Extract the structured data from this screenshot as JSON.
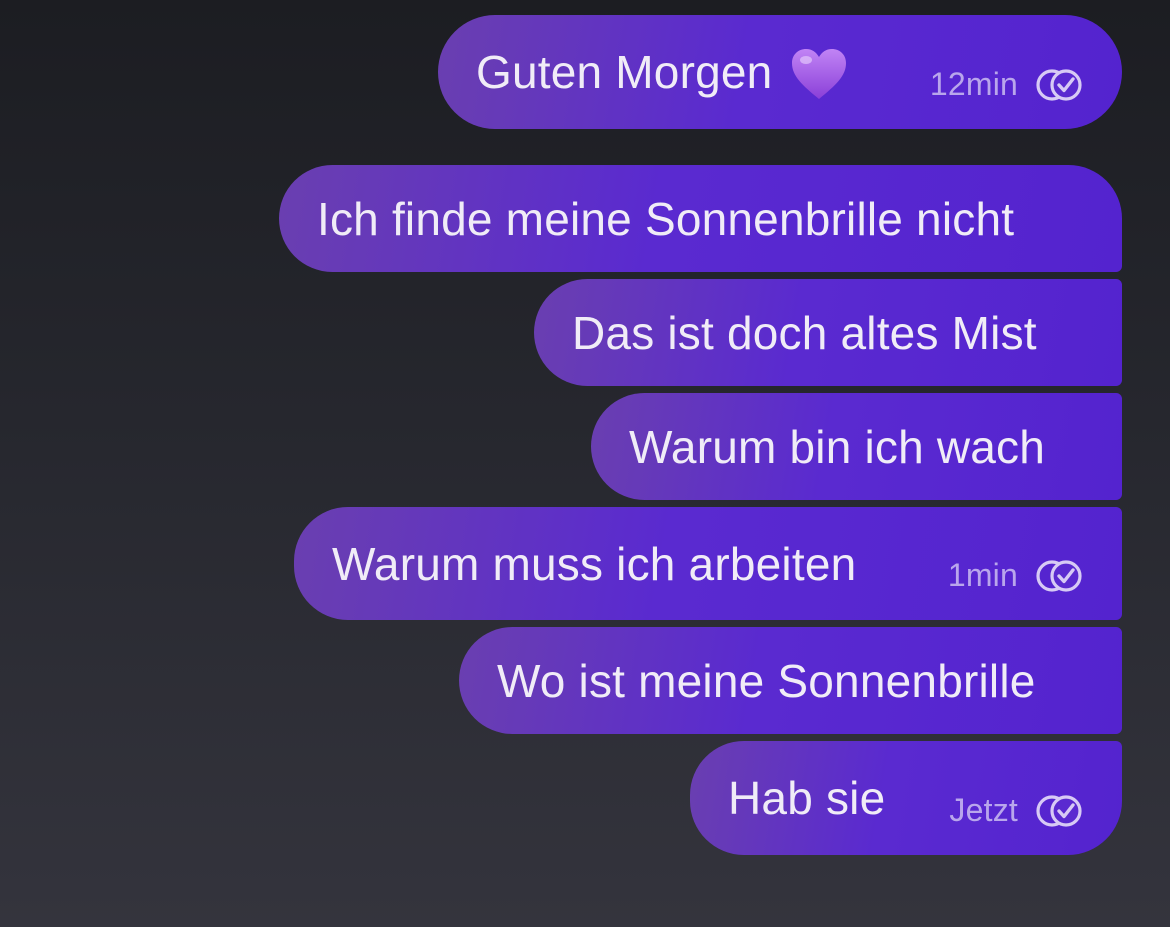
{
  "conversation": {
    "messages": [
      {
        "text": "Guten Morgen",
        "emoji": "purple-heart",
        "time": "12min",
        "status_icon": "read-check-icon"
      },
      {
        "text": "Ich finde meine Sonnenbrille nicht"
      },
      {
        "text": "Das ist doch altes Mist"
      },
      {
        "text": "Warum bin ich wach"
      },
      {
        "text": "Warum muss ich arbeiten",
        "time": "1min",
        "status_icon": "read-check-icon"
      },
      {
        "text": "Wo ist meine Sonnenbrille"
      },
      {
        "text": "Hab sie",
        "time": "Jetzt",
        "status_icon": "read-check-icon"
      }
    ]
  },
  "colors": {
    "background_top": "#1c1d22",
    "background_bottom": "#34343d",
    "bubble_purple": "#5a2ad0",
    "bubble_text": "#f0ecf7",
    "meta_text": "#b9a6ec",
    "heart": "#a259e6"
  }
}
